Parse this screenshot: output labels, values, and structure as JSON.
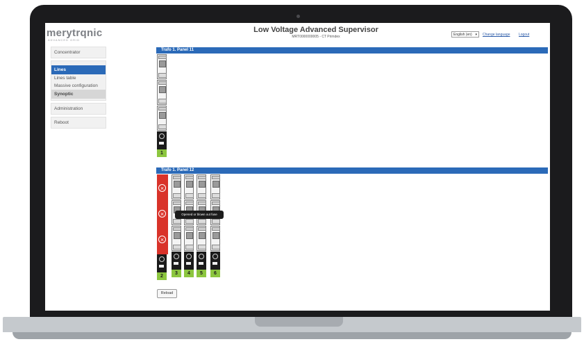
{
  "app": {
    "logo": "merytrqnic",
    "logo_sub": "ADVANCED GRID",
    "title": "Low Voltage Advanced Supervisor",
    "subtitle": "MRT0000000005 - CT Primdex"
  },
  "header": {
    "language_value": "English (en)",
    "change_language_label": "Change language",
    "logout_label": "Logout"
  },
  "sidebar": {
    "concentrator": "Concentrator",
    "lines": "Lines",
    "lines_table": "Lines table",
    "massive_configuration": "Massive configuration",
    "synoptic": "Synoptic",
    "administration": "Administration",
    "reboot": "Reboot"
  },
  "panels": [
    {
      "title": "Trafo 1. Panel 11",
      "lines": [
        "1"
      ]
    },
    {
      "title": "Trafo 1. Panel 12",
      "lines": [
        "2",
        "3",
        "4",
        "5",
        "6"
      ]
    }
  ],
  "tooltip": "Opened or blown out fuse",
  "reload_label": "Reload",
  "colors": {
    "accent": "#2b6ab8",
    "alarm": "#d9332a",
    "ok": "#8cc63f"
  }
}
